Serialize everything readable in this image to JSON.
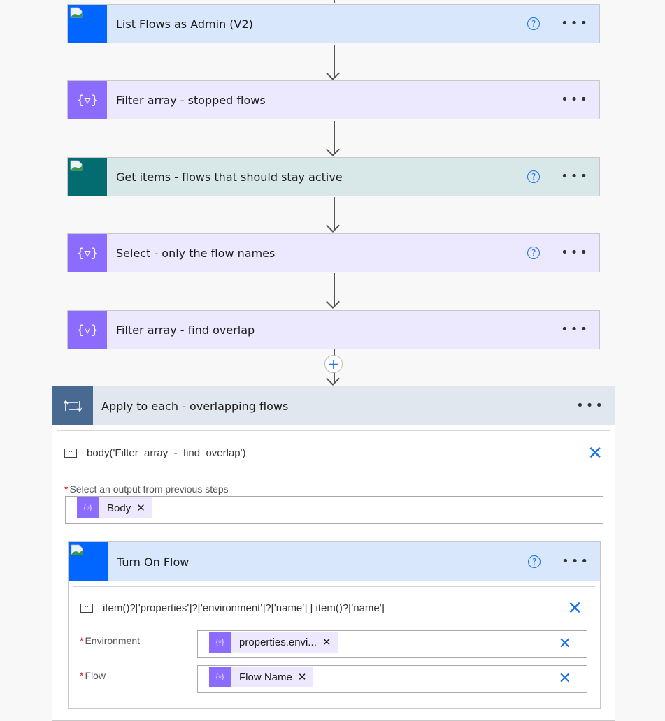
{
  "colors": {
    "connector_blue_bg": "#d9e7fd",
    "connector_blue_icon": "#0066ff",
    "data_op_bg": "#ece8fd",
    "data_op_icon": "#8c6cff",
    "sharepoint_bg": "#d8e8e8",
    "sharepoint_icon": "#036c70",
    "scope_bg": "#e1e7ef",
    "scope_icon": "#486991",
    "accent": "#1a73e8"
  },
  "steps": [
    {
      "title": "List Flows as Admin (V2)",
      "icon": "broken-image-icon",
      "has_help": true
    },
    {
      "title": "Filter array - stopped flows",
      "icon": "filter-array-icon",
      "has_help": false
    },
    {
      "title": "Get items - flows that should stay active",
      "icon": "broken-image-icon",
      "has_help": true
    },
    {
      "title": "Select - only the flow names",
      "icon": "data-operation-icon",
      "has_help": true
    },
    {
      "title": "Filter array - find overlap",
      "icon": "filter-array-icon",
      "has_help": false
    }
  ],
  "icons": {
    "brace": "{▿}",
    "help": "?",
    "more": "•••",
    "plus": "+",
    "close": "✕",
    "loop": "⮏",
    "token_x": "✕"
  },
  "apply_to_each": {
    "title": "Apply to each - overlapping flows",
    "expression": "body('Filter_array_-_find_overlap')",
    "output_label": "Select an output from previous steps",
    "required_mark": "*",
    "token": "Body"
  },
  "turn_on_flow": {
    "title": "Turn On Flow",
    "expression": "item()?['properties']?['environment']?['name'] | item()?['name']",
    "fields": [
      {
        "label": "Environment",
        "token": "properties.envi..."
      },
      {
        "label": "Flow",
        "token": "Flow Name"
      }
    ]
  }
}
